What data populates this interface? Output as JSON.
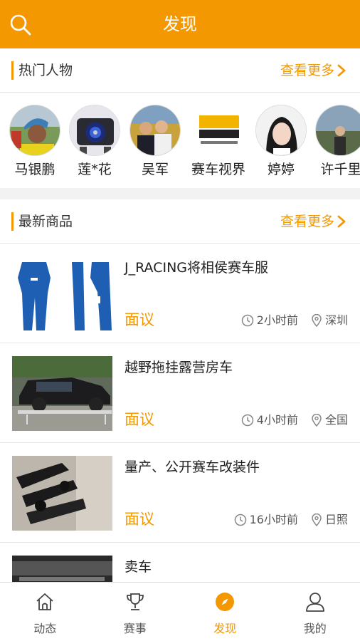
{
  "header": {
    "title": "发现",
    "icon": "search-icon"
  },
  "people_section": {
    "title": "热门人物",
    "more": "查看更多",
    "people": [
      {
        "name": "马银鹏"
      },
      {
        "name": "莲*花"
      },
      {
        "name": "吴军"
      },
      {
        "name": "赛车视界"
      },
      {
        "name": "婷婷"
      },
      {
        "name": "许千里"
      }
    ]
  },
  "goods_section": {
    "title": "最新商品",
    "more": "查看更多",
    "items": [
      {
        "title": "J_RACING将相侯赛车服",
        "price": "面议",
        "time": "2小时前",
        "location": "深圳"
      },
      {
        "title": "越野拖挂露营房车",
        "price": "面议",
        "time": "4小时前",
        "location": "全国"
      },
      {
        "title": "量产、公开赛车改装件",
        "price": "面议",
        "time": "16小时前",
        "location": "日照"
      },
      {
        "title": "卖车"
      }
    ]
  },
  "tabs": [
    {
      "label": "动态",
      "icon": "home-icon"
    },
    {
      "label": "赛事",
      "icon": "trophy-icon"
    },
    {
      "label": "发现",
      "icon": "compass-icon",
      "active": true
    },
    {
      "label": "我的",
      "icon": "user-icon"
    }
  ],
  "colors": {
    "accent": "#f39800",
    "background": "#f2f2f2"
  }
}
